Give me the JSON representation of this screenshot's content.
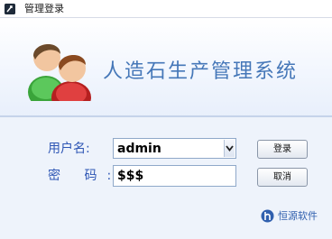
{
  "window": {
    "title": "管理登录"
  },
  "banner": {
    "app_title": "人造石生产管理系统"
  },
  "form": {
    "username_label": "用户名:",
    "username_value": "admin",
    "password_label": "密  码:",
    "password_value": "$$$"
  },
  "buttons": {
    "login": "登录",
    "cancel": "取消"
  },
  "footer": {
    "brand": "恒源软件"
  },
  "icons": [
    "app-icon",
    "users-icon",
    "chevron-down-icon",
    "brand-logo-icon"
  ],
  "colors": {
    "label": "#2f57b5",
    "title": "#4577b8",
    "accent": "#c5d3ea"
  }
}
